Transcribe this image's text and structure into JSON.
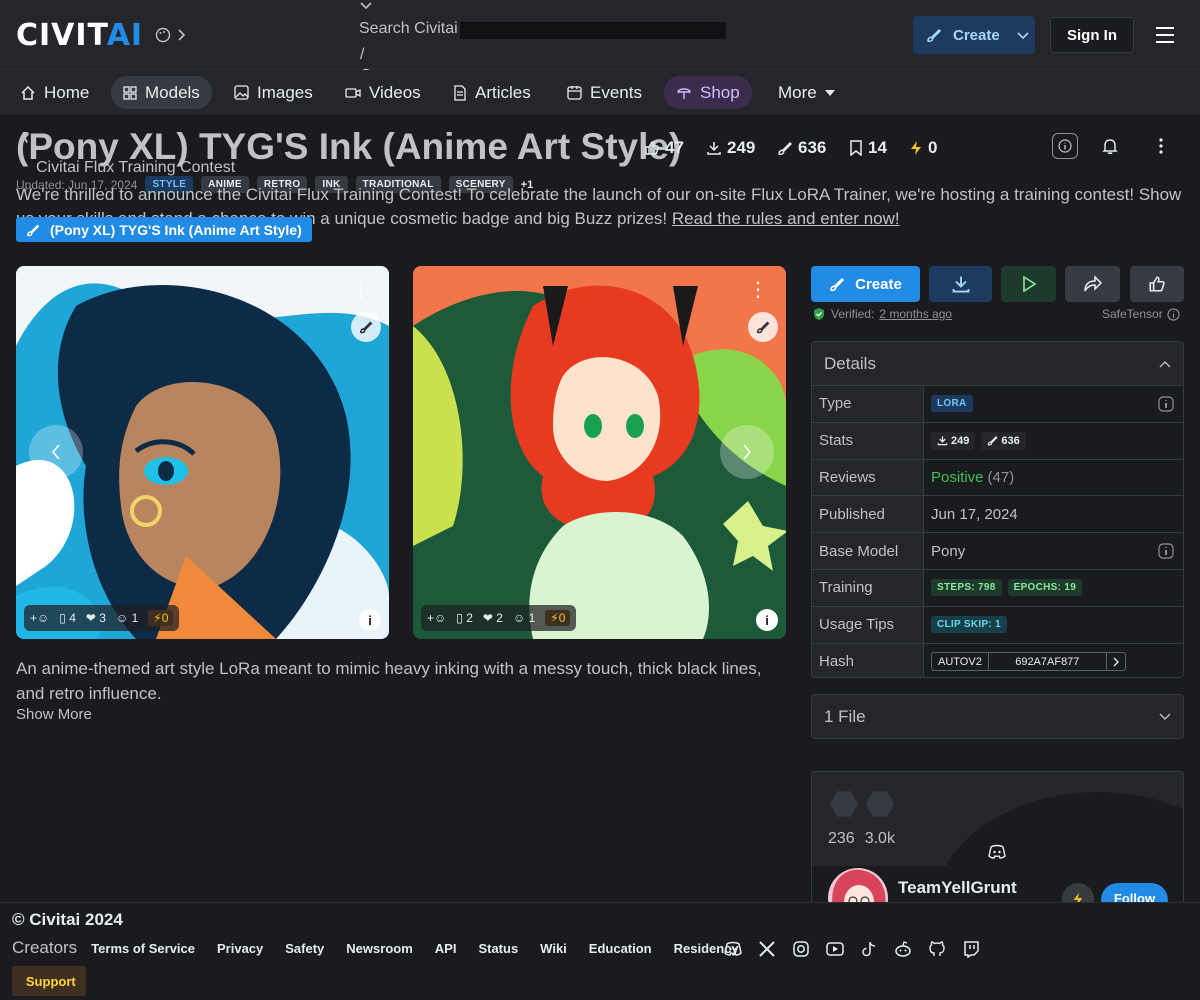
{
  "header": {
    "logo_main": "CIVIT",
    "logo_accent": "AI",
    "search_placeholder": "Search Civitai",
    "search_shortcut": "/",
    "create_label": "Create",
    "signin_label": "Sign In"
  },
  "nav": {
    "items": [
      {
        "label": "Home",
        "icon": "home-icon"
      },
      {
        "label": "Models",
        "icon": "grid-icon"
      },
      {
        "label": "Images",
        "icon": "image-icon"
      },
      {
        "label": "Videos",
        "icon": "video-icon"
      },
      {
        "label": "Articles",
        "icon": "article-icon"
      },
      {
        "label": "Events",
        "icon": "calendar-icon"
      },
      {
        "label": "Shop",
        "icon": "shop-icon"
      },
      {
        "label": "More",
        "icon": "caret-down-icon"
      }
    ]
  },
  "model": {
    "title": "(Pony XL) TYG'S Ink (Anime Art Style)",
    "stats": {
      "likes": "47",
      "downloads": "249",
      "generations": "636",
      "bookmarks": "14",
      "buzz": "0"
    },
    "updated": "Updated: Jun 17, 2024",
    "tags": [
      "STYLE",
      "ANIME",
      "RETRO",
      "INK",
      "TRADITIONAL",
      "SCENERY"
    ],
    "tags_more": "+1",
    "pill_label": "(Pony XL) TYG'S Ink (Anime Art Style)",
    "description": "An anime-themed art style LoRa meant to mimic heavy inking with a messy touch, thick black lines, and retro influence.",
    "show_more": "Show More"
  },
  "contest": {
    "close": "✗",
    "title": "Civitai Flux Training Contest",
    "icon": "",
    "text": "We're thrilled to announce the Civitai Flux Training Contest! To celebrate the launch of our on-site Flux LoRA Trainer, we're hosting a training contest! Show us your skills and stand a chance to win a unique cosmetic badge and big Buzz prizes!",
    "link": "Read the rules and enter now!"
  },
  "images": [
    {
      "comments": "4",
      "hearts": "3",
      "laughs": "1",
      "buzz": "0"
    },
    {
      "comments": "2",
      "hearts": "2",
      "laughs": "1",
      "buzz": "0"
    }
  ],
  "sidebar": {
    "create_label": "Create",
    "verified_label": "Verified:",
    "verified_when": "2 months ago",
    "safetensor": "SafeTensor",
    "details_title": "Details",
    "details": {
      "type_label": "Type",
      "type": "LORA",
      "stats_label": "Stats",
      "downloads": "249",
      "generations": "636",
      "reviews_label": "Reviews",
      "reviews_sentiment": "Positive",
      "reviews_count": "(47)",
      "published_label": "Published",
      "published": "Jun 17, 2024",
      "base_label": "Base Model",
      "base": "Pony",
      "training_label": "Training",
      "steps": "STEPS: 798",
      "epochs": "EPOCHS: 19",
      "tips_label": "Usage Tips",
      "clip": "CLIP SKIP: 1",
      "hash_label": "Hash",
      "hash_type": "AUTOV2",
      "hash": "692A7AF877"
    },
    "files_label": "1 File",
    "creator": {
      "uploads": "236",
      "followers": "3.0k",
      "name": "TeamYellGrunt",
      "follow": "Follow"
    }
  },
  "footer": {
    "copyright": "© Civitai 2024",
    "links": [
      "Creators",
      "Terms of Service",
      "Privacy",
      "Safety",
      "Newsroom",
      "API",
      "Status",
      "Wiki",
      "Education",
      "Residency"
    ],
    "support": "Support",
    "support_icon": ""
  },
  "colors": {
    "accent": "#228be6",
    "bg": "#1a1b1e",
    "panel": "#25262b"
  }
}
